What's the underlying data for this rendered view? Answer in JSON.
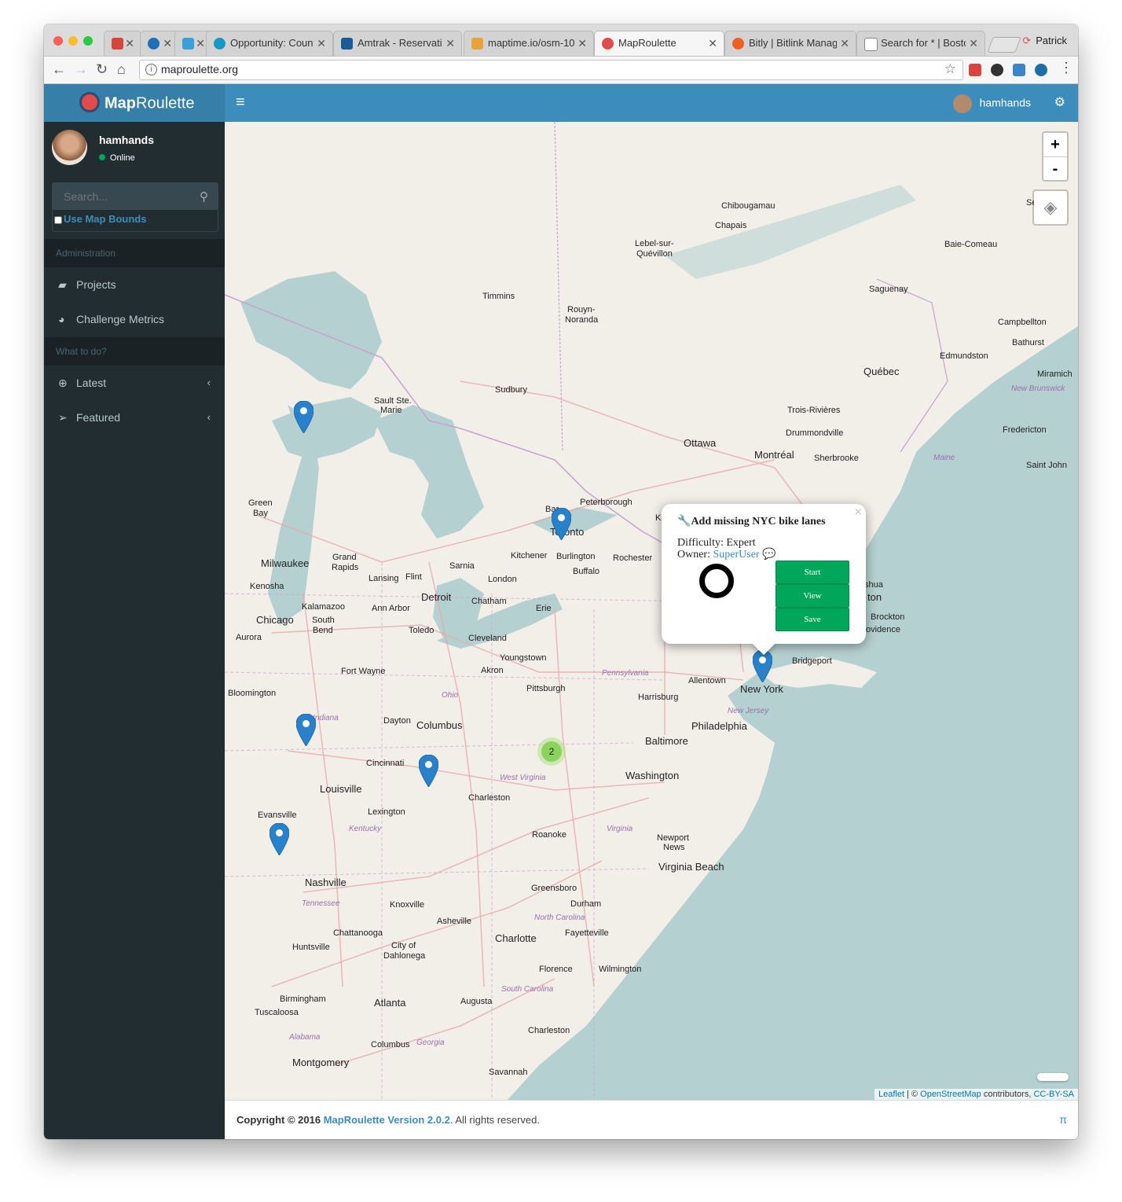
{
  "browser": {
    "tabs": [
      {
        "label": "",
        "icon": "gmail-icon",
        "color": "#d44638"
      },
      {
        "label": "",
        "icon": "circle-app-icon",
        "color": "#1f6fb2"
      },
      {
        "label": "",
        "icon": "app-icon",
        "color": "#3aa0d8"
      },
      {
        "label": "Opportunity: Count",
        "icon": "salesforce-icon",
        "color": "#1798c1"
      },
      {
        "label": "Amtrak - Reservatio",
        "icon": "amtrak-icon",
        "color": "#1a5a96"
      },
      {
        "label": "maptime.io/osm-10",
        "icon": "maptime-icon",
        "color": "#e8a33d"
      },
      {
        "label": "MapRoulette",
        "icon": "maproulette-icon",
        "color": "#e04b4b"
      },
      {
        "label": "Bitly | Bitlink Manag",
        "icon": "bitly-icon",
        "color": "#ee6123"
      },
      {
        "label": "Search for * | Bosto",
        "icon": "page-icon",
        "color": "#888888"
      }
    ],
    "profile_name": "Patrick",
    "url": "maproulette.org"
  },
  "app": {
    "logo_bold": "Map",
    "logo_light": "Roulette",
    "username": "hamhands",
    "status": "Online",
    "search_placeholder": "Search...",
    "use_map_bounds": "Use Map Bounds",
    "sections": {
      "admin": "Administration",
      "what": "What to do?"
    },
    "menu": {
      "projects": "Projects",
      "metrics": "Challenge Metrics",
      "latest": "Latest",
      "featured": "Featured"
    }
  },
  "map": {
    "zoom_in": "+",
    "zoom_out": "-",
    "cluster_count": "2",
    "attribution_leaflet": "Leaflet",
    "attribution_mid": " | © ",
    "attribution_osm": "OpenStreetMap",
    "attribution_tail": " contributors, ",
    "attribution_license": "CC-BY-SA",
    "popup": {
      "title": "Add missing NYC bike lanes",
      "difficulty": "Difficulty: Expert",
      "owner_label": "Owner: ",
      "owner": "SuperUser",
      "start": "Start",
      "view": "View",
      "save": "Save"
    },
    "labels": {
      "chibougamau": "Chibougamau",
      "chapais": "Chapais",
      "lebel": "Lebel-sur-",
      "quevillon": "Quévillon",
      "baie": "Baie-Comeau",
      "sept": "Sept",
      "saguenay": "Saguenay",
      "timmins": "Timmins",
      "rouyn": "Rouyn-",
      "noranda": "Noranda",
      "campbellton": "Campbellton",
      "bathurst": "Bathurst",
      "edmundston": "Edmundston",
      "quebec": "Québec",
      "miramich": "Miramich",
      "newbrunswick": "New Brunswick",
      "sudbury": "Sudbury",
      "saultste": "Sault Ste.",
      "marie": "Marie",
      "troisrivieres": "Trois-Rivières",
      "drummondville": "Drummondville",
      "fredericton": "Fredericton",
      "ottawa": "Ottawa",
      "montreal": "Montréal",
      "sherbrooke": "Sherbrooke",
      "maine": "Maine",
      "saintjohn": "Saint John",
      "green": "Green",
      "bay": "Bay",
      "peterborough": "Peterborough",
      "toronto": "Toronto",
      "milwaukee": "Milwaukee",
      "grand": "Grand",
      "rapids": "Rapids",
      "lansing": "Lansing",
      "flint": "Flint",
      "sarnia": "Sarnia",
      "kitchener": "Kitchener",
      "burlington": "Burlington",
      "rochester": "Rochester",
      "kenosha": "Kenosha",
      "london": "London",
      "buffalo": "Buffalo",
      "detroit": "Detroit",
      "kalamazoo": "Kalamazoo",
      "annarbor": "Ann Arbor",
      "chatham": "Chatham",
      "erie": "Erie",
      "chicago": "Chicago",
      "southbend": "South",
      "bend": "Bend",
      "toledo": "Toledo",
      "cleveland": "Cleveland",
      "aurora": "Aurora",
      "youngstown": "Youngstown",
      "fortwayne": "Fort Wayne",
      "akron": "Akron",
      "pennsylvania": "Pennsylvania",
      "allentown": "Allentown",
      "bridgeport": "Bridgeport",
      "newyork": "New York",
      "brockton": "Brockton",
      "providence": "ovidence",
      "bloomington": "Bloomington",
      "ohio": "Ohio",
      "pittsburgh": "Pittsburgh",
      "harrisburg": "Harrisburg",
      "newjersey": "New Jersey",
      "dayton": "Dayton",
      "columbus": "Columbus",
      "indiana": "Indiana",
      "philadelphia": "Philadelphia",
      "baltimore": "Baltimore",
      "cincinnati": "Cincinnati",
      "washington": "Washington",
      "louisville": "Louisville",
      "westvirginia": "West Virginia",
      "charleston": "Charleston",
      "evansville": "Evansville",
      "lexington": "Lexington",
      "kentucky": "Kentucky",
      "roanoke": "Roanoke",
      "virginia": "Virginia",
      "newport": "Newport",
      "news": "News",
      "virginiabeach": "Virginia Beach",
      "nashville": "Nashville",
      "greensboro": "Greensboro",
      "tennessee": "Tennessee",
      "knoxville": "Knoxville",
      "durham": "Durham",
      "asheville": "Asheville",
      "northcarolina": "North Carolina",
      "fayetteville": "Fayetteville",
      "chattanooga": "Chattanooga",
      "charlotte": "Charlotte",
      "huntsville": "Huntsville",
      "cityof": "City of",
      "dahlonega": "Dahlonega",
      "florence": "Florence",
      "wilmington": "Wilmington",
      "birmingham": "Birmingham",
      "atlanta": "Atlanta",
      "southcarolina": "South Carolina",
      "augusta": "Augusta",
      "tuscaloosa": "Tuscaloosa",
      "charlestonsc": "Charleston",
      "alabama": "Alabama",
      "columbusga": "Columbus",
      "georgia": "Georgia",
      "montgomery": "Montgomery",
      "savannah": "Savannah",
      "shua": "shua",
      "ton": "ton",
      "ki": "Ki",
      "bar": "Bar"
    }
  },
  "footer": {
    "copyright": "Copyright © 2016 ",
    "version": "MapRoulette Version 2.0.2",
    "rights": ". All rights reserved.",
    "pi": "π"
  }
}
